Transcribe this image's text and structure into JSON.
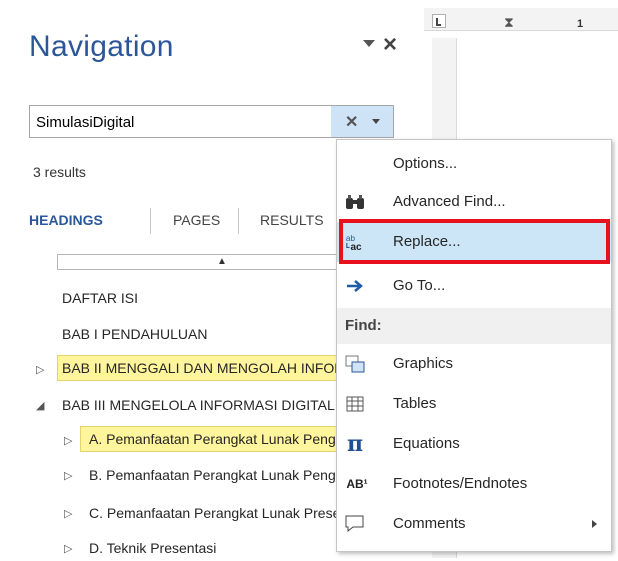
{
  "nav": {
    "title": "Navigation",
    "search_value": "SimulasiDigital",
    "results_count": "3 results",
    "tabs": [
      "HEADINGS",
      "PAGES",
      "RESULTS"
    ],
    "tree": [
      {
        "label": "DAFTAR ISI"
      },
      {
        "label": "BAB I PENDAHULUAN"
      },
      {
        "label": "BAB II MENGGALI DAN MENGOLAH INFORMASI"
      },
      {
        "label": "BAB III MENGELOLA INFORMASI DIGITAL"
      },
      {
        "label": "A.  Pemanfaatan Perangkat Lunak Pengolah Kata"
      },
      {
        "label": "B. Pemanfaatan Perangkat Lunak Pengolah Angka"
      },
      {
        "label": "C. Pemanfaatan Perangkat Lunak Presentasi"
      },
      {
        "label": "D. Teknik Presentasi"
      }
    ]
  },
  "ruler": {
    "number": "1"
  },
  "menu": {
    "items": [
      {
        "label": "Options...",
        "icon": "none"
      },
      {
        "label": "Advanced Find...",
        "icon": "binoculars-icon"
      },
      {
        "label": "Replace...",
        "icon": "replace-icon"
      },
      {
        "label": "Go To...",
        "icon": "arrow-right-icon"
      }
    ],
    "find_header": "Find:",
    "find_items": [
      {
        "label": "Graphics",
        "icon": "graphics-icon"
      },
      {
        "label": "Tables",
        "icon": "table-icon"
      },
      {
        "label": "Equations",
        "icon": "pi-icon"
      },
      {
        "label": "Footnotes/Endnotes",
        "icon": "footnote-icon"
      },
      {
        "label": "Comments",
        "icon": "comment-icon"
      }
    ],
    "icon_glyphs": {
      "pi": "π",
      "footnote": "AB¹"
    }
  },
  "colors": {
    "accent": "#2b579a",
    "highlight": "#fff59d",
    "selected": "#cde6f7",
    "replace_outline": "#e8101d"
  }
}
